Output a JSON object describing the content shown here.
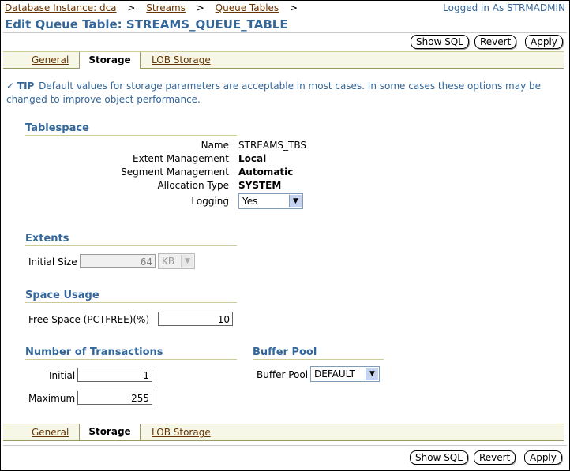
{
  "breadcrumb": {
    "items": [
      "Database Instance: dca",
      "Streams",
      "Queue Tables"
    ],
    "separator": ">"
  },
  "login_text": "Logged in As STRMADMIN",
  "page_title": "Edit Queue Table: STREAMS_QUEUE_TABLE",
  "buttons": {
    "show_sql": "Show SQL",
    "revert": "Revert",
    "apply": "Apply"
  },
  "tabs": [
    {
      "label": "General",
      "active": false
    },
    {
      "label": "Storage",
      "active": true
    },
    {
      "label": "LOB Storage",
      "active": false
    }
  ],
  "tip": {
    "label": "TIP",
    "text": "Default values for storage parameters are acceptable in most cases. In some cases these options may be changed to improve object performance."
  },
  "tablespace": {
    "header": "Tablespace",
    "name_label": "Name",
    "name_value": "STREAMS_TBS",
    "extent_label": "Extent Management",
    "extent_value": "Local",
    "segment_label": "Segment Management",
    "segment_value": "Automatic",
    "alloc_label": "Allocation Type",
    "alloc_value": "SYSTEM",
    "logging_label": "Logging",
    "logging_value": "Yes"
  },
  "extents": {
    "header": "Extents",
    "initial_label": "Initial Size",
    "initial_value": "64",
    "unit_value": "KB"
  },
  "space_usage": {
    "header": "Space Usage",
    "free_label": "Free Space (PCTFREE)(%)",
    "free_value": "10"
  },
  "transactions": {
    "header": "Number of Transactions",
    "initial_label": "Initial",
    "initial_value": "1",
    "maximum_label": "Maximum",
    "maximum_value": "255"
  },
  "buffer_pool": {
    "header": "Buffer Pool",
    "label": "Buffer Pool",
    "value": "DEFAULT"
  },
  "colors": {
    "header_blue": "#336699",
    "link_brown": "#663300",
    "tab_bg": "#f7f7e7"
  }
}
